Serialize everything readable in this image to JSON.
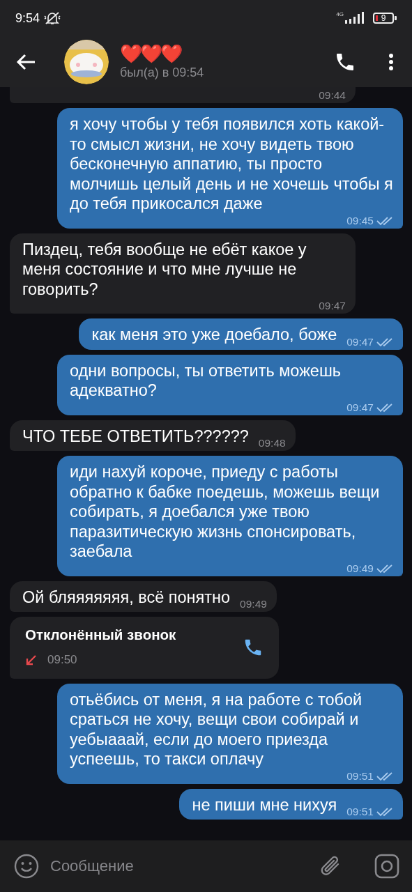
{
  "status_bar": {
    "time": "9:54",
    "network": "4G",
    "battery": "9"
  },
  "header": {
    "title": "❤️❤️❤️",
    "subtitle": "был(а) в 09:54"
  },
  "messages": [
    {
      "kind": "text",
      "outgoing": false,
      "time": "09:44"
    },
    {
      "kind": "text",
      "outgoing": true,
      "read": true,
      "text": "я хочу чтобы у тебя появился хоть какой-то смысл жизни, не хочу видеть твою бесконечную аппатию, ты просто молчишь целый день и не хочешь чтобы я до тебя прикосался даже",
      "time": "09:45"
    },
    {
      "kind": "text",
      "outgoing": false,
      "text": "Пиздец, тебя вообще не ебёт какое у меня состояние и что мне лучше не говорить?",
      "time": "09:47"
    },
    {
      "kind": "text",
      "outgoing": true,
      "read": true,
      "text": "как меня это уже доебало, боже",
      "time": "09:47"
    },
    {
      "kind": "text",
      "outgoing": true,
      "read": true,
      "text": "одни вопросы, ты ответить можешь адекватно?",
      "time": "09:47"
    },
    {
      "kind": "text",
      "outgoing": false,
      "text": "ЧТО ТЕБЕ ОТВЕТИТЬ??????",
      "time": "09:48"
    },
    {
      "kind": "text",
      "outgoing": true,
      "read": true,
      "text": "иди нахуй короче, приеду с работы обратно к бабке поедешь, можешь вещи собирать, я доебался уже твою паразитическую жизнь спонсировать, заебала",
      "time": "09:49"
    },
    {
      "kind": "text",
      "outgoing": false,
      "text": "Ой бляяяяяяя, всё понятно",
      "time": "09:49"
    },
    {
      "kind": "call",
      "outgoing": false,
      "text": "Отклонённый звонок",
      "time": "09:50"
    },
    {
      "kind": "text",
      "outgoing": true,
      "read": true,
      "text": "отьёбись от меня, я на работе с тобой сраться не хочу, вещи свои собирай и уебыааай, если до моего приезда успеешь, то такси оплачу",
      "time": "09:51"
    },
    {
      "kind": "text",
      "outgoing": true,
      "read": true,
      "text": "не пиши мне нихуя",
      "time": "09:51"
    }
  ],
  "input": {
    "placeholder": "Сообщение"
  }
}
